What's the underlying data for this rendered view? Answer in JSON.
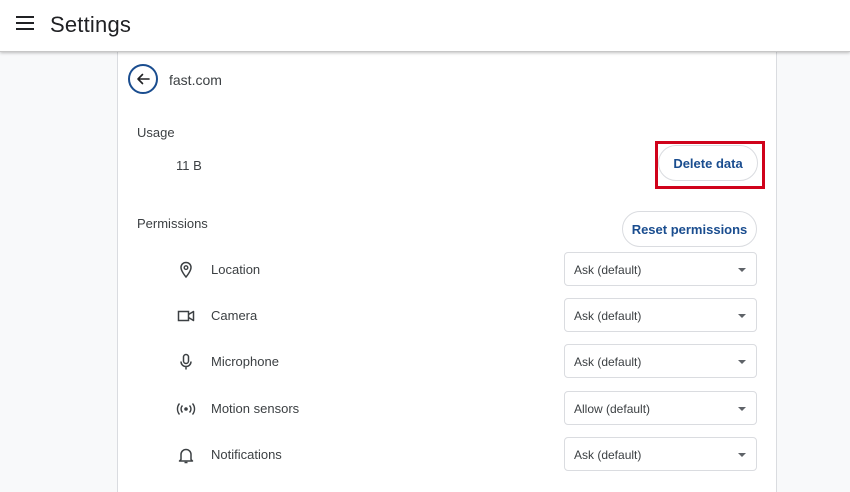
{
  "header": {
    "title": "Settings",
    "menu_icon": "hamburger-menu-icon"
  },
  "site": {
    "name": "fast.com",
    "back_icon": "arrow-back-icon"
  },
  "usage": {
    "label": "Usage",
    "value": "11 B",
    "delete_button": "Delete data"
  },
  "permissions": {
    "label": "Permissions",
    "reset_button": "Reset permissions",
    "items": [
      {
        "icon": "location-pin-icon",
        "label": "Location",
        "value": "Ask (default)"
      },
      {
        "icon": "camera-icon",
        "label": "Camera",
        "value": "Ask (default)"
      },
      {
        "icon": "microphone-icon",
        "label": "Microphone",
        "value": "Ask (default)"
      },
      {
        "icon": "motion-sensors-icon",
        "label": "Motion sensors",
        "value": "Allow (default)"
      },
      {
        "icon": "bell-icon",
        "label": "Notifications",
        "value": "Ask (default)"
      }
    ]
  },
  "colors": {
    "accent": "#1a4d8f",
    "highlight": "#d0021b",
    "text": "#3c4043"
  }
}
